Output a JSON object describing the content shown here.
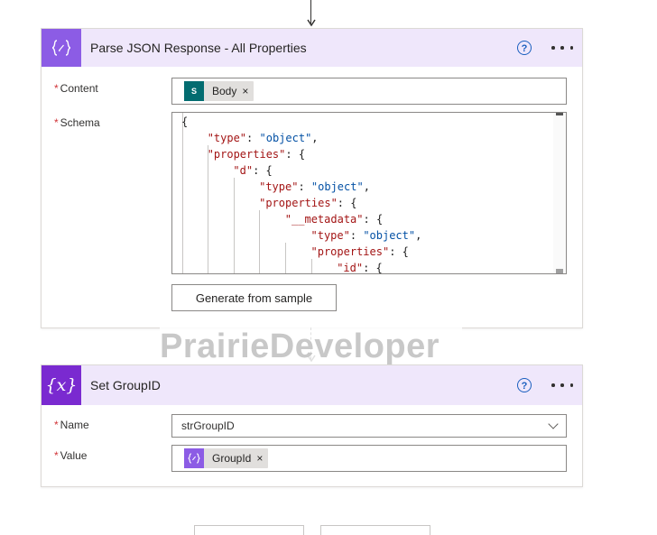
{
  "parse_card": {
    "title": "Parse JSON Response - All Properties",
    "icon": "curly-braces-icon",
    "help_glyph": "?",
    "content_label": "Content",
    "required_mark": "*",
    "content_token": {
      "label": "Body",
      "remove": "×",
      "icon_text": "S"
    },
    "schema_label": "Schema",
    "schema_lines": [
      [
        {
          "t": "p",
          "v": "{"
        }
      ],
      [
        {
          "t": "k",
          "v": "\"type\""
        },
        {
          "t": "p",
          "v": ": "
        },
        {
          "t": "s",
          "v": "\"object\""
        },
        {
          "t": "p",
          "v": ","
        }
      ],
      [
        {
          "t": "k",
          "v": "\"properties\""
        },
        {
          "t": "p",
          "v": ": {"
        }
      ],
      [
        {
          "t": "k",
          "v": "\"d\""
        },
        {
          "t": "p",
          "v": ": {"
        }
      ],
      [
        {
          "t": "k",
          "v": "\"type\""
        },
        {
          "t": "p",
          "v": ": "
        },
        {
          "t": "s",
          "v": "\"object\""
        },
        {
          "t": "p",
          "v": ","
        }
      ],
      [
        {
          "t": "k",
          "v": "\"properties\""
        },
        {
          "t": "p",
          "v": ": {"
        }
      ],
      [
        {
          "t": "k",
          "v": "\"__metadata\""
        },
        {
          "t": "p",
          "v": ": {"
        }
      ],
      [
        {
          "t": "k",
          "v": "\"type\""
        },
        {
          "t": "p",
          "v": ": "
        },
        {
          "t": "s",
          "v": "\"object\""
        },
        {
          "t": "p",
          "v": ","
        }
      ],
      [
        {
          "t": "k",
          "v": "\"properties\""
        },
        {
          "t": "p",
          "v": ": {"
        }
      ],
      [
        {
          "t": "k",
          "v": "\"id\""
        },
        {
          "t": "p",
          "v": ": {"
        }
      ]
    ],
    "generate_button": "Generate from sample"
  },
  "set_card": {
    "title": "Set GroupID",
    "icon": "variable-x-icon",
    "icon_text": "{x}",
    "help_glyph": "?",
    "required_mark": "*",
    "name_label": "Name",
    "name_value": "strGroupID",
    "value_label": "Value",
    "value_token": {
      "label": "GroupId",
      "remove": "×"
    }
  },
  "watermark": "PrairieDeveloper",
  "colors": {
    "parse_icon_bg": "#8c5ce5",
    "set_icon_bg": "#7a2ad0",
    "header_bg": "#efe7fb",
    "sharepoint_bg": "#036c70",
    "required": "#d13438",
    "help": "#1a5fbf"
  }
}
